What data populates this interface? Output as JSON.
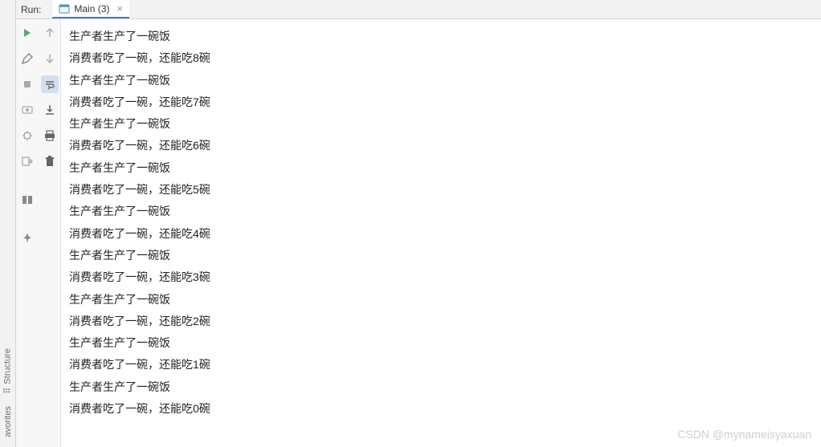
{
  "header": {
    "run_label": "Run:",
    "tab_title": "Main (3)"
  },
  "watermark": "CSDN @mynameisyaxuan",
  "vertical_tabs": {
    "structure": "Structure",
    "favorites": "avorites"
  },
  "console_lines": [
    "生产者生产了一碗饭",
    "消费者吃了一碗，还能吃8碗",
    "生产者生产了一碗饭",
    "消费者吃了一碗，还能吃7碗",
    "生产者生产了一碗饭",
    "消费者吃了一碗，还能吃6碗",
    "生产者生产了一碗饭",
    "消费者吃了一碗，还能吃5碗",
    "生产者生产了一碗饭",
    "消费者吃了一碗，还能吃4碗",
    "生产者生产了一碗饭",
    "消费者吃了一碗，还能吃3碗",
    "生产者生产了一碗饭",
    "消费者吃了一碗，还能吃2碗",
    "生产者生产了一碗饭",
    "消费者吃了一碗，还能吃1碗",
    "生产者生产了一碗饭",
    "消费者吃了一碗，还能吃0碗"
  ]
}
